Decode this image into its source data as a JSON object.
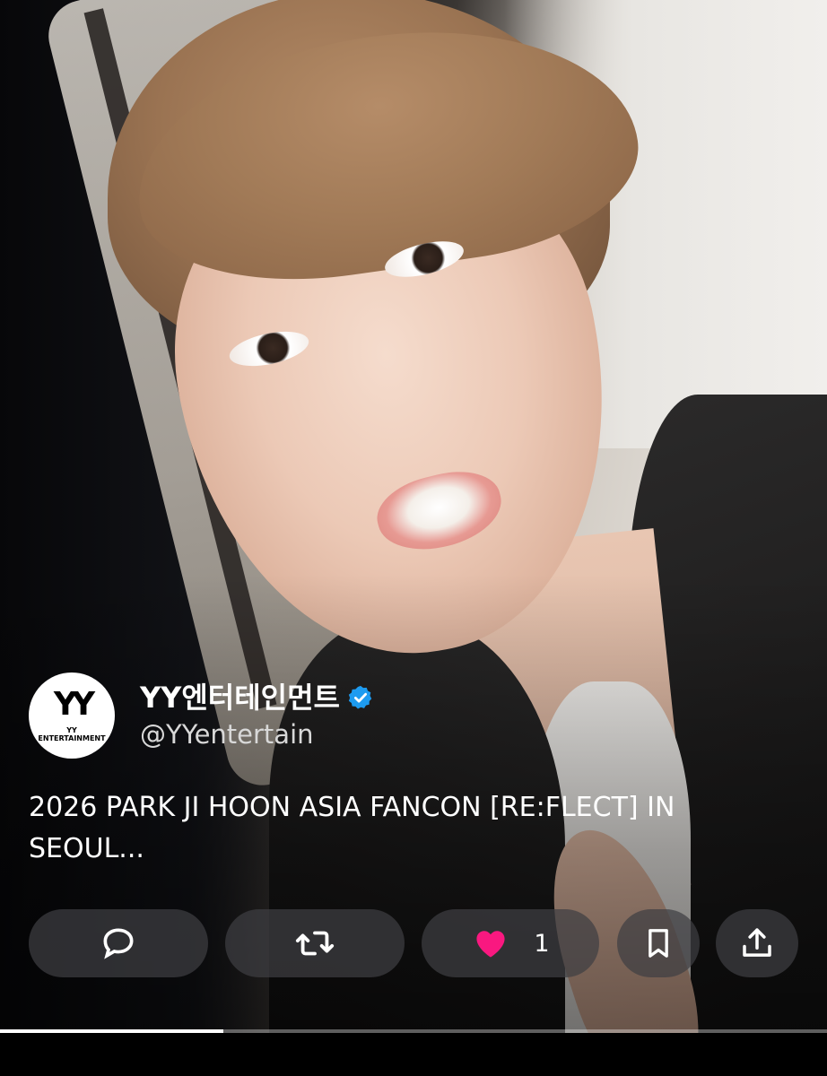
{
  "post": {
    "author": {
      "display_name": "YY엔터테인먼트",
      "handle": "@YYentertain",
      "verified": true,
      "avatar": {
        "mark": "YY",
        "brand_line1": "YY",
        "brand_line2": "ENTERTAINMENT",
        "icon": "yy-entertainment-logo"
      }
    },
    "text": "2026 PARK JI HOON ASIA FANCON [RE:FLECT] IN SEOUL...",
    "media": {
      "type": "video",
      "description_icon": "video-frame"
    }
  },
  "actions": {
    "reply": {
      "icon": "speech-bubble-icon"
    },
    "repost": {
      "icon": "repost-arrows-icon"
    },
    "like": {
      "icon": "heart-icon",
      "count": "1",
      "liked": true
    },
    "bookmark": {
      "icon": "bookmark-icon"
    },
    "share": {
      "icon": "share-upload-icon"
    }
  },
  "playback": {
    "progress_fraction": 0.27
  },
  "colors": {
    "verified_badge": "#1d9bf0",
    "like_active": "#f91880",
    "bookmark_bg": "#ffffff",
    "text_primary": "#ffffff",
    "text_secondary": "#d8d8d8"
  }
}
